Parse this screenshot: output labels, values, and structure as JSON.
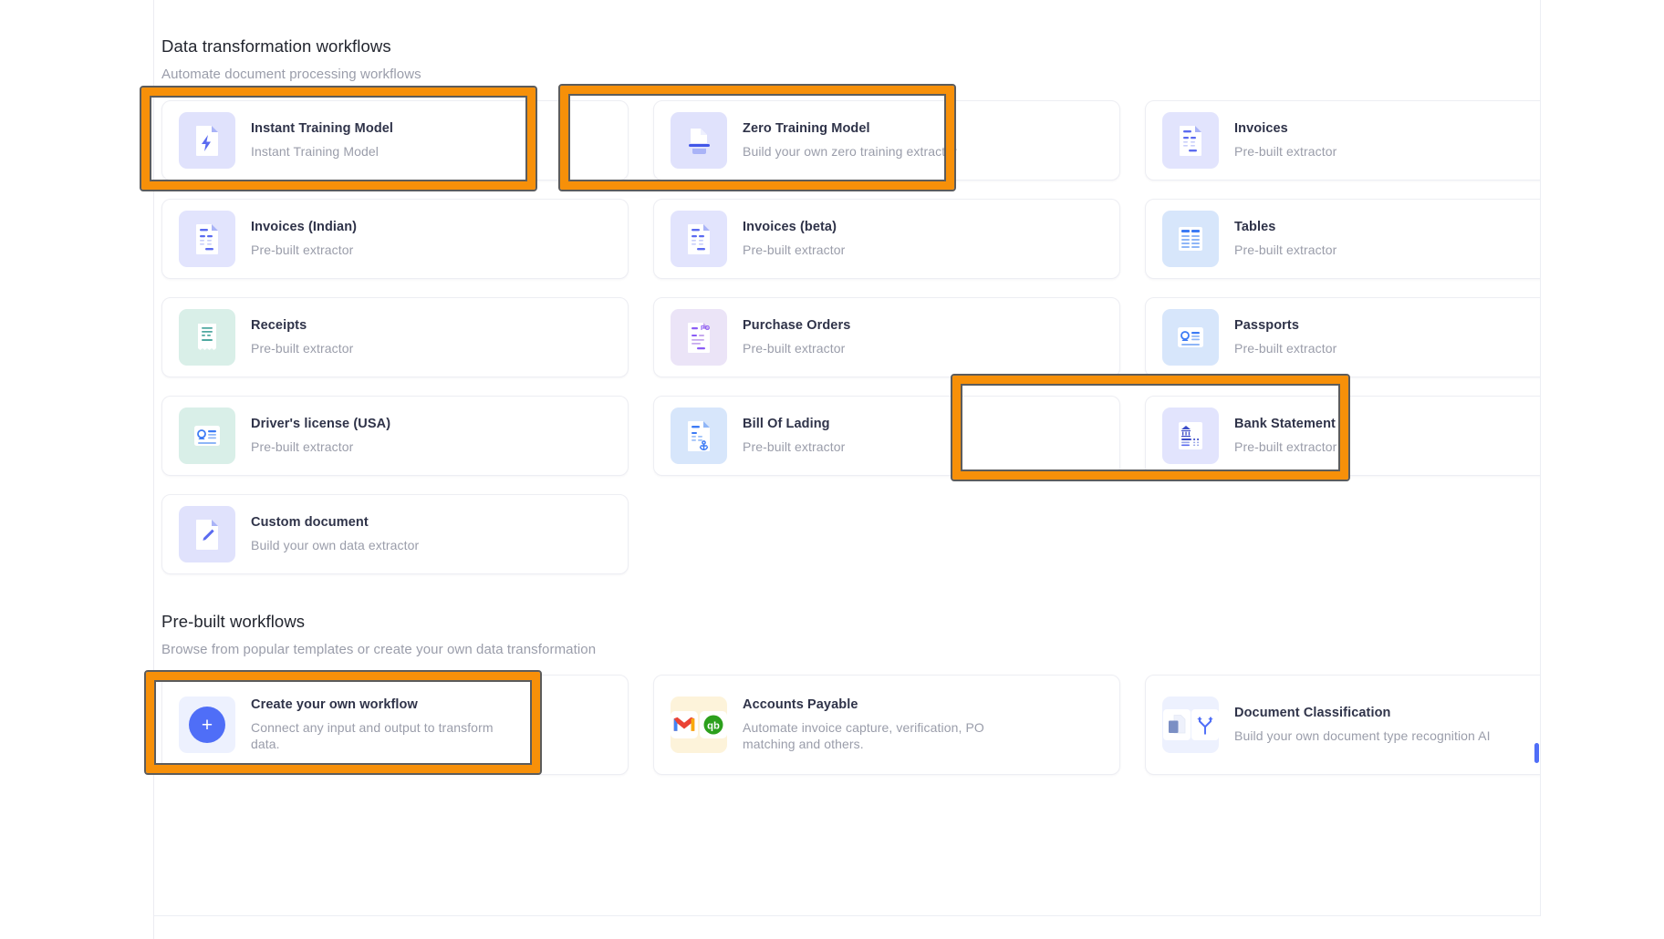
{
  "sections": [
    {
      "id": "data-transformation",
      "title": "Data transformation workflows",
      "subtitle": "Automate document processing workflows",
      "cards": [
        {
          "title": "Instant Training Model",
          "subtitle": "Instant Training Model",
          "icon": "lightning-document-icon",
          "thumb_bg": "#E0E2FC",
          "highlighted": true
        },
        {
          "title": "Zero Training Model",
          "subtitle": "Build your own zero training extractor",
          "icon": "stacked-document-icon",
          "thumb_bg": "#E0E2FC",
          "highlighted": true
        },
        {
          "title": "Invoices",
          "subtitle": "Pre-built extractor",
          "icon": "invoice-document-icon",
          "thumb_bg": "#E2E4FD",
          "highlighted": false
        },
        {
          "title": "Invoices (Indian)",
          "subtitle": "Pre-built extractor",
          "icon": "invoice-document-icon",
          "thumb_bg": "#E2E4FD",
          "highlighted": false
        },
        {
          "title": "Invoices (beta)",
          "subtitle": "Pre-built extractor",
          "icon": "invoice-document-icon",
          "thumb_bg": "#E2E4FD",
          "highlighted": false
        },
        {
          "title": "Tables",
          "subtitle": "Pre-built extractor",
          "icon": "table-grid-icon",
          "thumb_bg": "#D7E6FB",
          "highlighted": false
        },
        {
          "title": "Receipts",
          "subtitle": "Pre-built extractor",
          "icon": "receipt-icon",
          "thumb_bg": "#D9EFE8",
          "highlighted": false
        },
        {
          "title": "Purchase Orders",
          "subtitle": "Pre-built extractor",
          "icon": "purchase-order-icon",
          "thumb_bg": "#EBE4F7",
          "highlighted": false
        },
        {
          "title": "Passports",
          "subtitle": "Pre-built extractor",
          "icon": "id-card-icon",
          "thumb_bg": "#D7E6FB",
          "highlighted": false
        },
        {
          "title": "Driver's license (USA)",
          "subtitle": "Pre-built extractor",
          "icon": "id-card-icon",
          "thumb_bg": "#D9EFE8",
          "highlighted": false
        },
        {
          "title": "Bill Of Lading",
          "subtitle": "Pre-built extractor",
          "icon": "anchor-document-icon",
          "thumb_bg": "#D7E6FB",
          "highlighted": false
        },
        {
          "title": "Bank Statement",
          "subtitle": "Pre-built extractor",
          "icon": "bank-statement-icon",
          "thumb_bg": "#E2E4FD",
          "highlighted": true
        },
        {
          "title": "Custom document",
          "subtitle": "Build your own data extractor",
          "icon": "pencil-document-icon",
          "thumb_bg": "#E0E2FC",
          "highlighted": false
        }
      ]
    },
    {
      "id": "pre-built-workflows",
      "title": "Pre-built workflows",
      "subtitle": "Browse from popular templates or create your own data transformation",
      "cards": [
        {
          "title": "Create your own workflow",
          "subtitle": "Connect any input and output to transform data.",
          "icon": "plus-circle-icon",
          "thumb_bg": "#EDF1FE",
          "highlighted": true
        },
        {
          "title": "Accounts Payable",
          "subtitle": "Automate invoice capture, verification, PO matching and others.",
          "icon": "gmail-quickbooks-icon",
          "thumb_bg": "#FDF3DA",
          "highlighted": false
        },
        {
          "title": "Document Classification",
          "subtitle": "Build your own document type recognition AI",
          "icon": "document-branch-icon",
          "thumb_bg": "#EDF1FE",
          "highlighted": false
        }
      ]
    }
  ],
  "colors": {
    "highlight_orange": "#F79009",
    "highlight_outline": "#5C5C5C",
    "accent_blue": "#4F6EF7",
    "title_text": "#2F3349",
    "muted_text": "#9A9DAA"
  }
}
